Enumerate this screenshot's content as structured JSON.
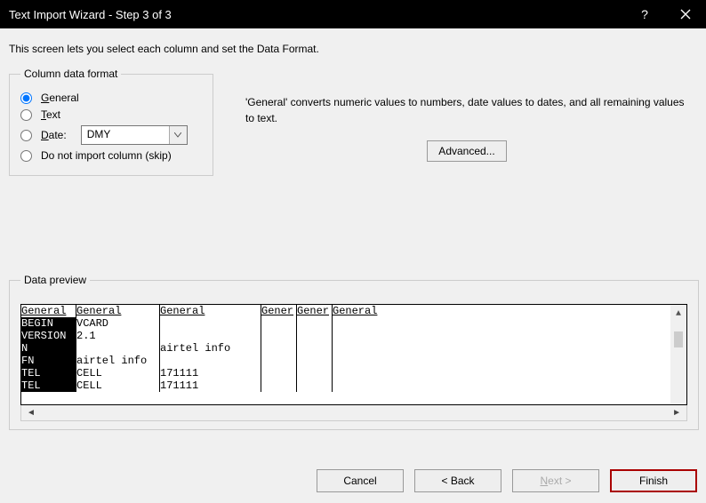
{
  "titlebar": {
    "title": "Text Import Wizard - Step 3 of 3"
  },
  "description": "This screen lets you select each column and set the Data Format.",
  "columnFormat": {
    "legend": "Column data format",
    "options": {
      "general": "General",
      "text": "Text",
      "date": "Date:",
      "skip": "Do not import column (skip)"
    },
    "dateValue": "DMY",
    "selected": "general"
  },
  "hint": "'General' converts numeric values to numbers, date values to dates, and all remaining values to text.",
  "advancedLabel": "Advanced...",
  "preview": {
    "legend": "Data preview",
    "headers": [
      "General",
      "General",
      "General",
      "Gener",
      "Gener",
      "General"
    ],
    "rows": [
      [
        "BEGIN",
        "VCARD",
        "",
        "",
        "",
        ""
      ],
      [
        "VERSION",
        "2.1",
        "",
        "",
        "",
        ""
      ],
      [
        "N",
        "",
        "airtel info",
        "",
        "",
        ""
      ],
      [
        "FN",
        "airtel info",
        "",
        "",
        "",
        ""
      ],
      [
        "TEL",
        "CELL",
        "171111",
        "",
        "",
        ""
      ],
      [
        "TEL",
        "CELL",
        "171111",
        "",
        "",
        ""
      ]
    ]
  },
  "buttons": {
    "cancel": "Cancel",
    "back": "< Back",
    "next": "Next >",
    "finish": "Finish"
  }
}
